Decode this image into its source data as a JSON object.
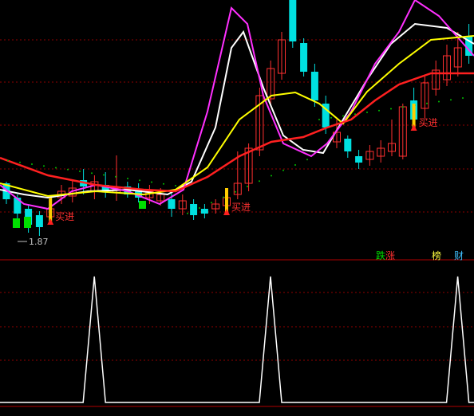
{
  "chart_data": {
    "type": "candlestick",
    "panels": [
      "price",
      "signal"
    ],
    "price_annotations": {
      "low_label": "1.87",
      "buy_label": "买进"
    },
    "tabs": [
      {
        "label_a": "跌",
        "label_b": "涨",
        "color_a": "#00e000",
        "color_b": "#ff3030"
      },
      {
        "label": "榜",
        "color": "#ffff40"
      },
      {
        "label": "财",
        "color": "#40c0ff"
      }
    ],
    "colors": {
      "up": "#ff3030",
      "down": "#00e0e0",
      "ma_white": "#ffffff",
      "ma_magenta": "#ff30ff",
      "ma_yellow": "#ffff00",
      "ma_red": "#ff2020",
      "dots": "#00c000",
      "grid": "#900000",
      "signal": "#ffffff"
    },
    "signal": {
      "ylim": [
        0,
        1
      ],
      "spikes_at_candle": [
        4,
        20,
        37
      ]
    },
    "buy_signals_at_candle": [
      4,
      20,
      37
    ]
  }
}
